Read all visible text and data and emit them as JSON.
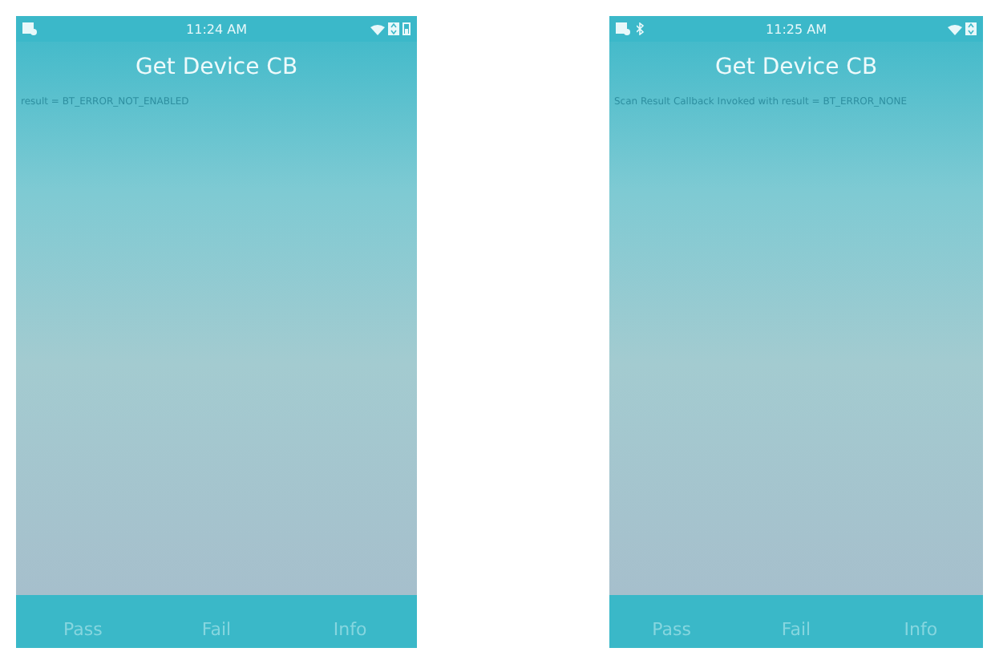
{
  "screens": [
    {
      "status_bar": {
        "time": "11:24 AM",
        "bluetooth_on": false
      },
      "title": "Get Device CB",
      "message": "result = BT_ERROR_NOT_ENABLED",
      "buttons": [
        "Pass",
        "Fail",
        "Info"
      ]
    },
    {
      "status_bar": {
        "time": "11:25 AM",
        "bluetooth_on": true
      },
      "title": "Get Device CB",
      "message": "Scan Result Callback Invoked with result = BT_ERROR_NONE",
      "buttons": [
        "Pass",
        "Fail",
        "Info"
      ]
    }
  ]
}
